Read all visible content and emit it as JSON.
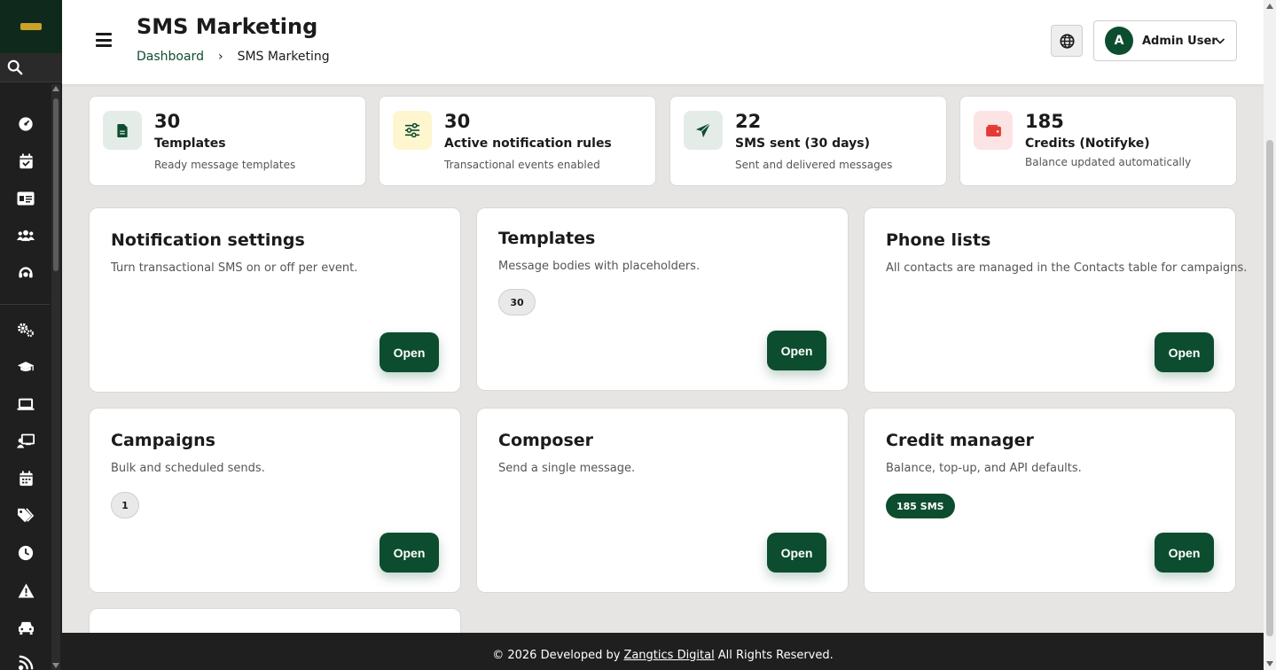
{
  "header": {
    "title": "SMS Marketing",
    "breadcrumb": {
      "home": "Dashboard",
      "separator": "›",
      "current": "SMS Marketing"
    },
    "user": {
      "initial": "A",
      "name": "Admin User"
    }
  },
  "stats": [
    {
      "value": "30",
      "label": "Templates",
      "sub": "Ready message templates",
      "icon": "document-icon",
      "bg": "#e4ece8",
      "fg": "#0d4d2f"
    },
    {
      "value": "30",
      "label": "Active notification rules",
      "sub": "Transactional events enabled",
      "icon": "sliders-icon",
      "bg": "#fdf6cf",
      "fg": "#0d4d2f"
    },
    {
      "value": "22",
      "label": "SMS sent (30 days)",
      "sub": "Sent and delivered messages",
      "icon": "paper-plane-icon",
      "bg": "#e4ece8",
      "fg": "#0d4d2f"
    },
    {
      "value": "185",
      "label": "Credits (Notifyke)",
      "sub": "Balance updated automatically",
      "icon": "wallet-icon",
      "bg": "#fde4e4",
      "fg": "#e53935"
    }
  ],
  "cards": [
    {
      "title": "Notification settings",
      "desc": "Turn transactional SMS on or off per event.",
      "button": "Open"
    },
    {
      "title": "Templates",
      "desc": "Message bodies with placeholders.",
      "badge": "30",
      "button": "Open"
    },
    {
      "title": "Phone lists",
      "desc": "All contacts are managed in the Contacts table for campaigns.",
      "button": "Open"
    },
    {
      "title": "Campaigns",
      "desc": "Bulk and scheduled sends.",
      "badge": "1",
      "button": "Open"
    },
    {
      "title": "Composer",
      "desc": "Send a single message.",
      "button": "Open"
    },
    {
      "title": "Credit manager",
      "desc": "Balance, top-up, and API defaults.",
      "badge": "185 SMS",
      "button": "Open"
    }
  ],
  "footer": {
    "prefix": "© 2026 Developed by",
    "company": "Zangtics Digital",
    "suffix": "All Rights Reserved."
  },
  "colors": {
    "brand": "#0d4d2f",
    "sidebar": "#1f1f1f",
    "background": "#e6e5e3"
  }
}
